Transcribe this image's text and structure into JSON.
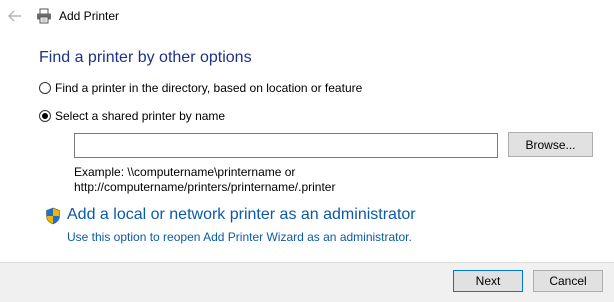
{
  "window": {
    "title": "Add Printer",
    "back_icon": "back-arrow-icon",
    "title_icon": "printer-icon"
  },
  "main": {
    "heading": "Find a printer by other options",
    "option_directory": "Find a printer in the directory, based on location or feature",
    "option_shared": "Select a shared printer by name",
    "selected_option": "shared",
    "printer_name_value": "",
    "browse_label": "Browse...",
    "example_line1": "Example: \\\\computername\\printername or",
    "example_line2": "http://computername/printers/printername/.printer",
    "admin_link": "Add a local or network printer as an administrator",
    "admin_sub": "Use this option to reopen Add Printer Wizard as an administrator.",
    "admin_icon": "uac-shield-icon"
  },
  "footer": {
    "next_label": "Next",
    "cancel_label": "Cancel"
  },
  "colors": {
    "heading": "#1e3287",
    "link": "#0b5aa8",
    "default_button_border": "#0078d7"
  }
}
